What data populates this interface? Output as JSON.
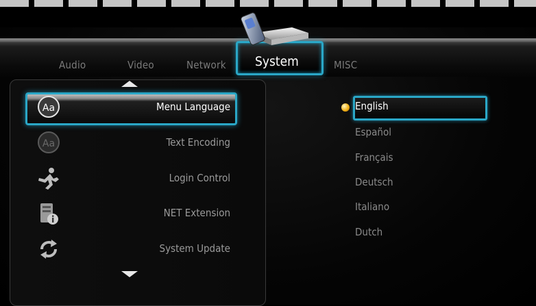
{
  "tabs": [
    {
      "label": "Audio",
      "selected": false
    },
    {
      "label": "Video",
      "selected": false
    },
    {
      "label": "Network",
      "selected": false
    },
    {
      "label": "System",
      "selected": true
    },
    {
      "label": "MISC",
      "selected": false
    }
  ],
  "system_menu": {
    "items": [
      {
        "label": "Menu Language",
        "icon": "text-aa-icon",
        "selected": true
      },
      {
        "label": "Text Encoding",
        "icon": "text-aa-dim-icon",
        "selected": false
      },
      {
        "label": "Login Control",
        "icon": "running-person-icon",
        "selected": false
      },
      {
        "label": "NET Extension",
        "icon": "server-info-icon",
        "selected": false
      },
      {
        "label": "System Update",
        "icon": "refresh-arrows-icon",
        "selected": false
      }
    ]
  },
  "language_options": {
    "selected": "English",
    "items": [
      "English",
      "Español",
      "Français",
      "Deutsch",
      "Italiano",
      "Dutch"
    ]
  },
  "colors": {
    "accent": "#2aa7c7",
    "bullet": "#f2b21a",
    "text_active": "#ffffff",
    "text_inactive": "#9a9a9a"
  }
}
